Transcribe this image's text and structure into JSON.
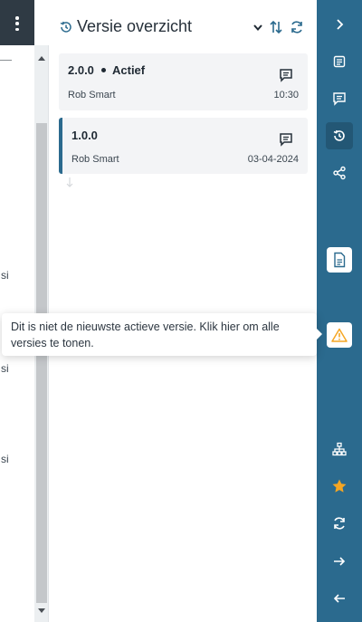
{
  "panel": {
    "title": "Versie overzicht"
  },
  "versions": [
    {
      "version": "2.0.0",
      "status": "Actief",
      "author": "Rob Smart",
      "date": "10:30"
    },
    {
      "version": "1.0.0",
      "author": "Rob Smart",
      "date": "03-04-2024"
    }
  ],
  "tooltip": {
    "text": "Dit is niet de nieuwste actieve versie. Klik hier om alle versies te tonen."
  },
  "background_fragments": [
    "si",
    "si",
    "si"
  ],
  "colors": {
    "sidebar": "#2b6a8e",
    "warning": "#f5a623",
    "star": "#f5a623"
  },
  "icons": {
    "header": [
      "history-icon",
      "chevron-down-icon",
      "sort-icon",
      "refresh-icon"
    ],
    "sidebar": [
      "chevron-right-icon",
      "document-icon",
      "comment-icon",
      "history-icon",
      "share-icon",
      "file-icon",
      "warning-icon",
      "hierarchy-icon",
      "star-icon",
      "sync-icon",
      "arrow-right-icon",
      "arrow-left-icon"
    ]
  }
}
